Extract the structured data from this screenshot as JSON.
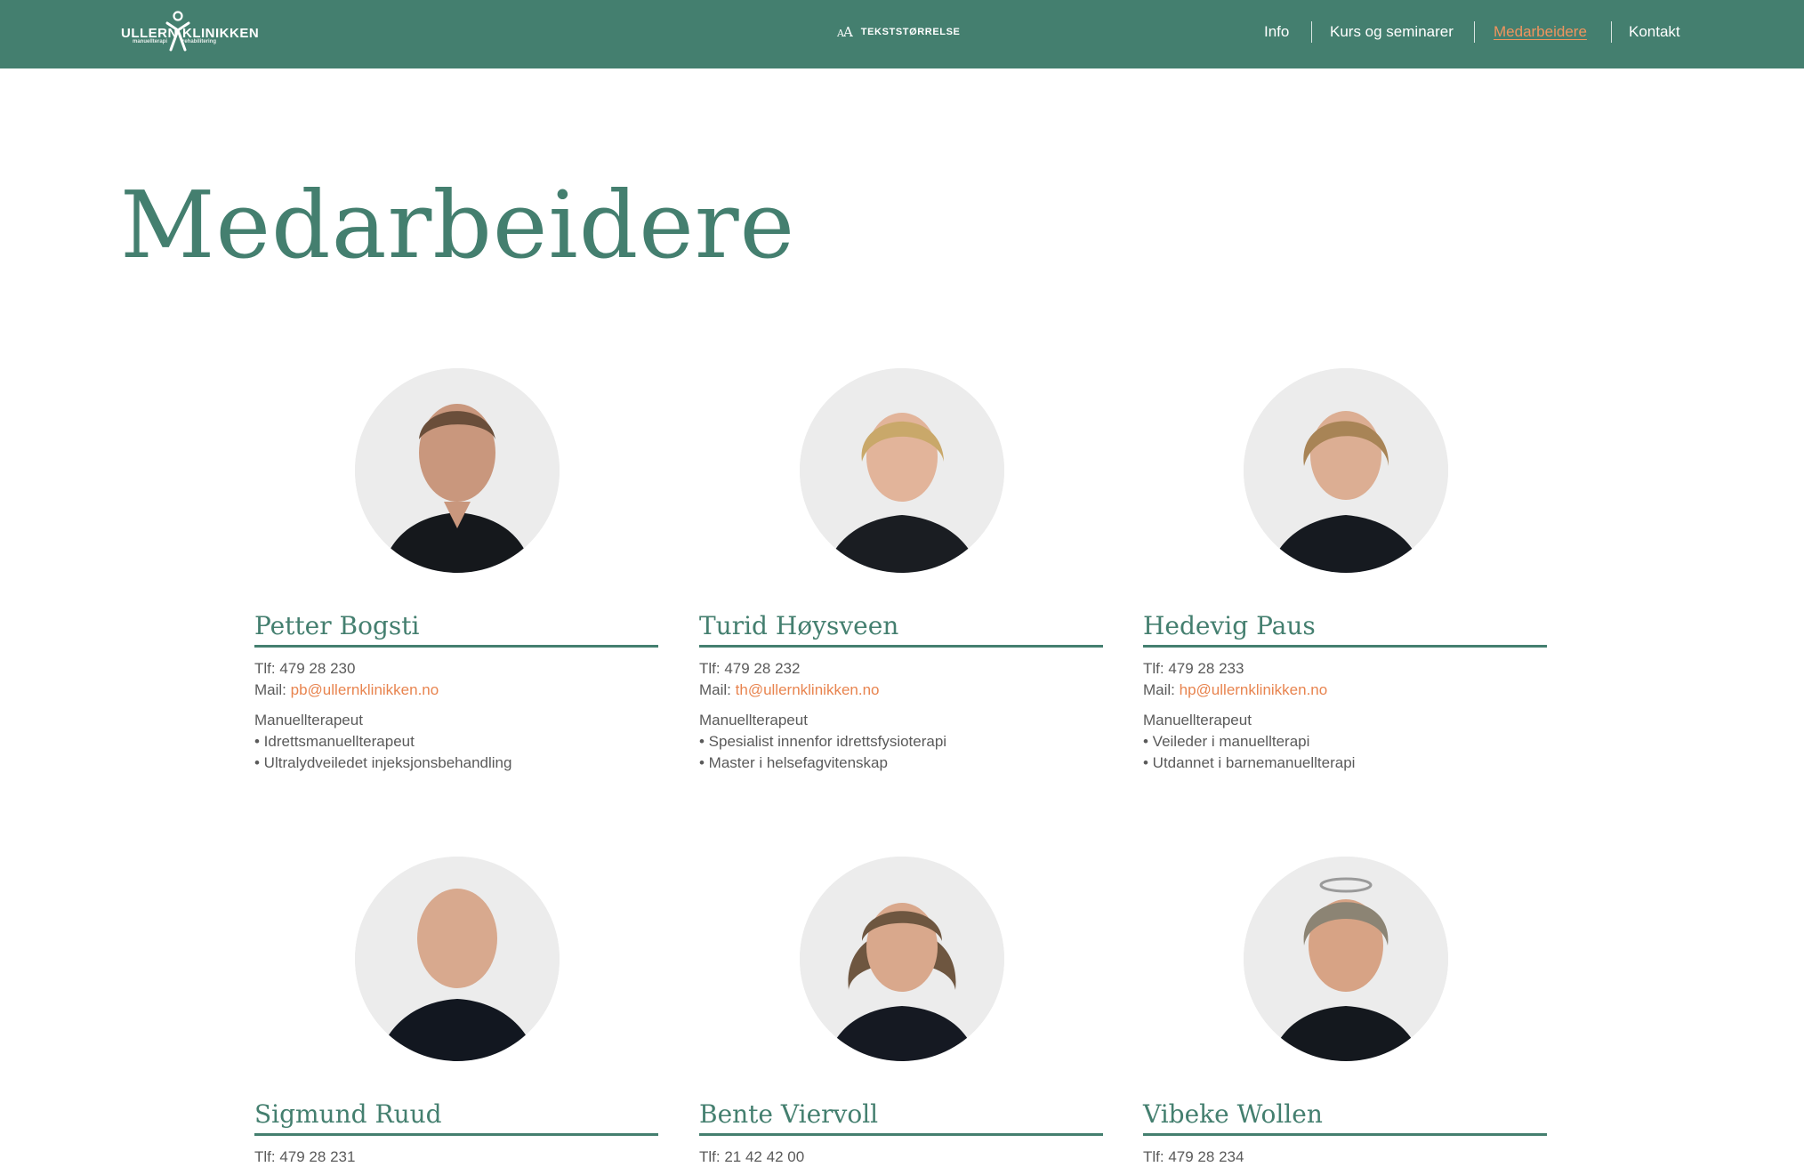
{
  "header": {
    "logo": {
      "left_word": "ULLERN",
      "right_word": "KLINIKKEN",
      "tag_left": "manuellterapi",
      "tag_right": "rehabilitering"
    },
    "text_size": {
      "icon_label": "AA",
      "label": "TEKSTSTØRRELSE"
    },
    "nav": [
      {
        "label": "Info"
      },
      {
        "label": "Kurs og seminarer"
      },
      {
        "label": "Medarbeidere",
        "active": true
      },
      {
        "label": "Kontakt"
      }
    ]
  },
  "page": {
    "title": "Medarbeidere"
  },
  "colors": {
    "brand": "#447f6f",
    "accent": "#e8844f",
    "text": "#5a5a5a",
    "photo_bg": "#ececec"
  },
  "staff": [
    {
      "name": "Petter Bogsti",
      "phone_label": "Tlf:",
      "phone": "479 28 230",
      "mail_label": "Mail:",
      "email": "pb@ullernklinikken.no",
      "title": "Manuellterapeut",
      "specialties": [
        "• Idrettsmanuellterapeut",
        "• Ultralydveiledet injeksjonsbehandling"
      ]
    },
    {
      "name": "Turid Høysveen",
      "phone_label": "Tlf:",
      "phone": "479 28 232",
      "mail_label": "Mail:",
      "email": "th@ullernklinikken.no",
      "title": "Manuellterapeut",
      "specialties": [
        "• Spesialist innenfor idrettsfysioterapi",
        "• Master i helsefagvitenskap"
      ]
    },
    {
      "name": "Hedevig Paus",
      "phone_label": "Tlf:",
      "phone": "479 28 233",
      "mail_label": "Mail:",
      "email": "hp@ullernklinikken.no",
      "title": "Manuellterapeut",
      "specialties": [
        "• Veileder i manuellterapi",
        "• Utdannet i barnemanuellterapi"
      ]
    },
    {
      "name": "Sigmund Ruud",
      "phone_label": "Tlf:",
      "phone": "479 28 231"
    },
    {
      "name": "Bente Viervoll",
      "phone_label": "Tlf:",
      "phone": "21 42 42 00"
    },
    {
      "name": "Vibeke Wollen",
      "phone_label": "Tlf:",
      "phone": "479 28 234"
    }
  ]
}
